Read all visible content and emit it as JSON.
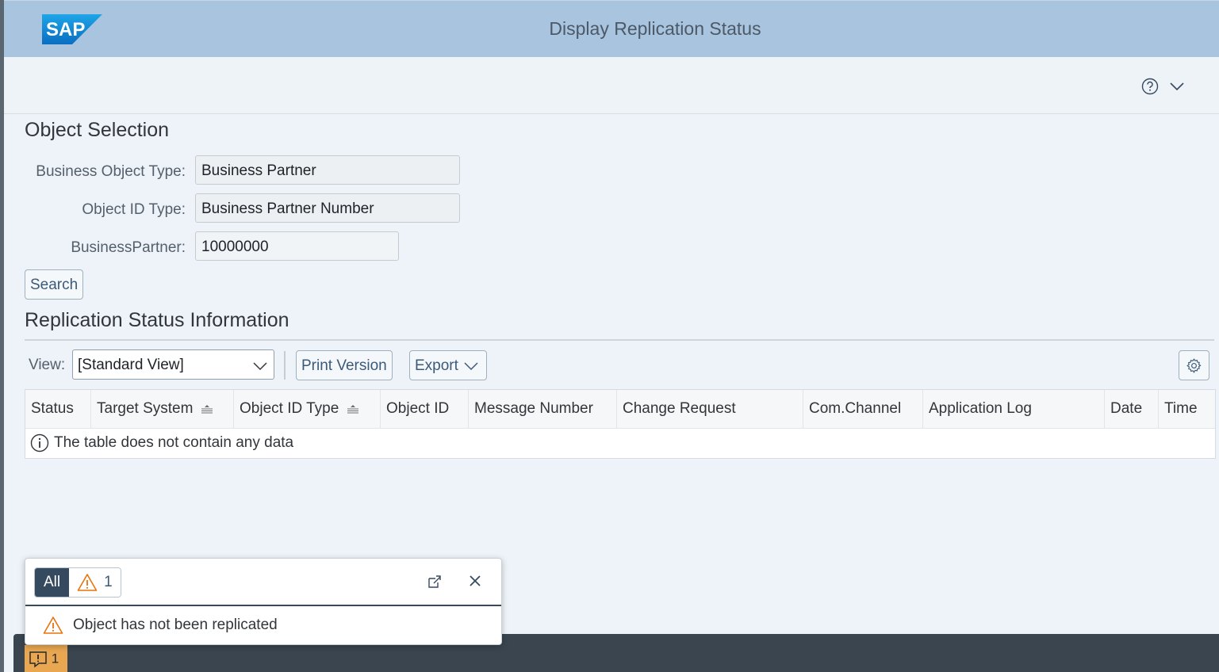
{
  "shell": {
    "logo_text": "SAP",
    "title": "Display Replication Status",
    "icons": [
      "help-icon",
      "chevron-down-icon"
    ]
  },
  "object_selection": {
    "title": "Object Selection",
    "fields": {
      "business_object_type": {
        "label": "Business Object Type:",
        "value": "Business Partner"
      },
      "object_id_type": {
        "label": "Object ID Type:",
        "value": "Business Partner Number"
      },
      "business_partner": {
        "label": "BusinessPartner:",
        "value": "10000000"
      }
    },
    "search_label": "Search"
  },
  "replication": {
    "title": "Replication Status Information",
    "toolbar": {
      "view_label": "View:",
      "view_value": "[Standard View]",
      "print_label": "Print Version",
      "export_label": "Export",
      "settings_icon": "gear-icon"
    },
    "columns": [
      "Status",
      "Target System",
      "Object ID Type",
      "Object ID",
      "Message Number",
      "Change Request",
      "Com.Channel",
      "Application Log",
      "Date",
      "Time"
    ],
    "empty_text": "The table does not contain any data"
  },
  "messages": {
    "filter_all": "All",
    "warning_count": "1",
    "message_text": "Object has not been replicated",
    "toggle_count": "1",
    "colors": {
      "warning": "#e9730c",
      "toggle_bg": "#e9a751"
    }
  }
}
